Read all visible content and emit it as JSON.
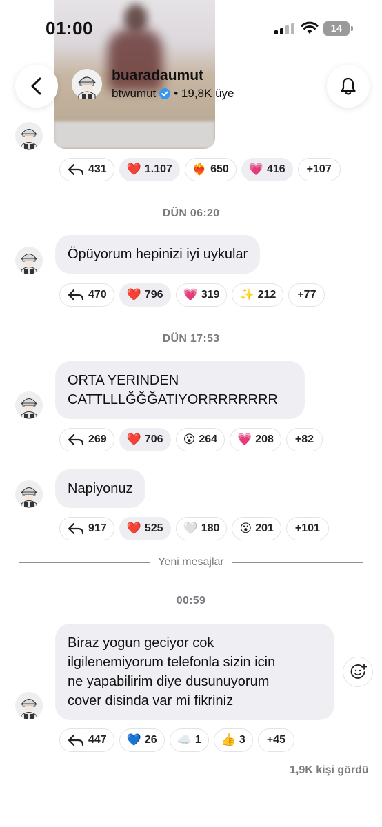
{
  "status_bar": {
    "time": "01:00",
    "battery": "14"
  },
  "header": {
    "channel_name": "buaradaumut",
    "owner": "btwumut",
    "members": "• 19,8K üye"
  },
  "messages": [
    {
      "id": "photo",
      "text": "",
      "reactions": [
        {
          "icon": "reply-icon",
          "emoji": "",
          "count": "431"
        },
        {
          "icon": "red-heart-icon",
          "emoji": "❤️",
          "count": "1.107",
          "active": true
        },
        {
          "icon": "heart-on-fire-icon",
          "emoji": "❤️‍🔥",
          "count": "650"
        },
        {
          "icon": "sparkling-heart-icon",
          "emoji": "💗",
          "count": "416"
        }
      ],
      "more": "+107"
    },
    {
      "id": "m1",
      "time": "DÜN 06:20",
      "text": "Öpüyorum hepinizi iyi uykular",
      "reactions": [
        {
          "icon": "reply-icon",
          "emoji": "",
          "count": "470"
        },
        {
          "icon": "red-heart-icon",
          "emoji": "❤️",
          "count": "796",
          "active": true
        },
        {
          "icon": "sparkling-heart-icon",
          "emoji": "💗",
          "count": "319"
        },
        {
          "icon": "sparkles-icon",
          "emoji": "✨",
          "count": "212"
        }
      ],
      "more": "+77"
    },
    {
      "id": "m2",
      "time": "DÜN 17:53",
      "text_line1": "ORTA YERINDEN",
      "text_line2": "CATTLLLĞĞĞATIYORRRRRRRR",
      "reactions": [
        {
          "icon": "reply-icon",
          "emoji": "",
          "count": "269"
        },
        {
          "icon": "red-heart-icon",
          "emoji": "❤️",
          "count": "706",
          "active": true
        },
        {
          "icon": "surprised-face-icon",
          "emoji": "😮",
          "count": "264"
        },
        {
          "icon": "sparkling-heart-icon",
          "emoji": "💗",
          "count": "208"
        }
      ],
      "more": "+82"
    },
    {
      "id": "m3",
      "text": "Napiyonuz",
      "reactions": [
        {
          "icon": "reply-icon",
          "emoji": "",
          "count": "917"
        },
        {
          "icon": "red-heart-icon",
          "emoji": "❤️",
          "count": "525",
          "active": true
        },
        {
          "icon": "white-heart-icon",
          "emoji": "🤍",
          "count": "180"
        },
        {
          "icon": "surprised-face-icon",
          "emoji": "😮",
          "count": "201"
        }
      ],
      "more": "+101"
    },
    {
      "id": "m4",
      "time": "00:59",
      "text_line1": "Biraz yogun geciyor cok",
      "text_line2": "ilgilenemiyorum telefonla sizin icin",
      "text_line3": "ne yapabilirim diye dusunuyorum",
      "text_line4": "cover disinda var mi fikriniz",
      "reactions": [
        {
          "icon": "reply-icon",
          "emoji": "",
          "count": "447"
        },
        {
          "icon": "blue-heart-icon",
          "emoji": "💙",
          "count": "26"
        },
        {
          "icon": "cloud-icon",
          "emoji": "☁️",
          "count": "1"
        },
        {
          "icon": "thumbs-up-icon",
          "emoji": "👍",
          "count": "3"
        }
      ],
      "more": "+45"
    }
  ],
  "new_messages_label": "Yeni mesajlar",
  "seen_label": "1,9K kişi gördü",
  "colors": {
    "bubble": "#efeff3",
    "muted": "#7a7a80",
    "verified": "#3897f0"
  }
}
